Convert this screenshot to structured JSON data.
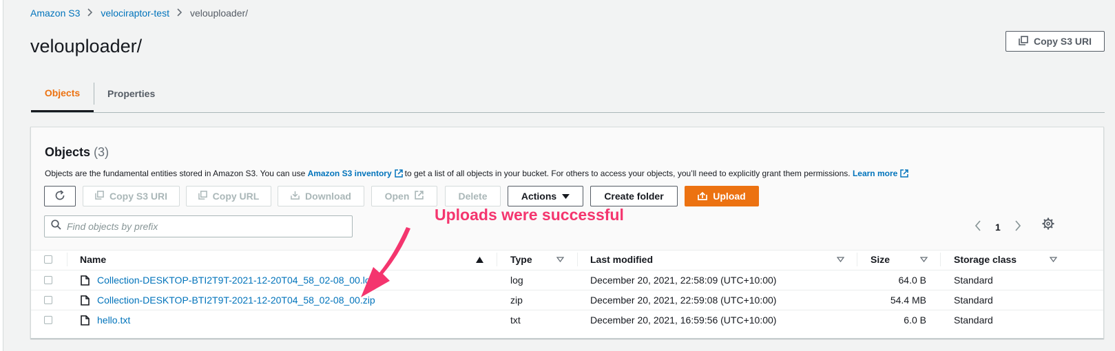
{
  "breadcrumb": {
    "root": "Amazon S3",
    "bucket": "velociraptor-test",
    "current": "velouploader/"
  },
  "page": {
    "title": "velouploader/",
    "copy_uri_label": "Copy S3 URI"
  },
  "tabs": [
    {
      "label": "Objects",
      "active": true
    },
    {
      "label": "Properties",
      "active": false
    }
  ],
  "objects_panel": {
    "title": "Objects",
    "count": "(3)",
    "desc_prefix": "Objects are the fundamental entities stored in Amazon S3. You can use",
    "inventory_link": "Amazon S3 inventory",
    "desc_middle": "to get a list of all objects in your bucket. For others to access your objects, you’ll need to explicitly grant them permissions.",
    "learn_more": "Learn more"
  },
  "toolbar": {
    "copy_s3_uri": "Copy S3 URI",
    "copy_url": "Copy URL",
    "download": "Download",
    "open": "Open",
    "delete": "Delete",
    "actions": "Actions",
    "create_folder": "Create folder",
    "upload": "Upload"
  },
  "search": {
    "placeholder": "Find objects by prefix",
    "value": ""
  },
  "pagination": {
    "current_page": "1"
  },
  "annotation": {
    "text": "Uploads were successful",
    "color": "#f4356e"
  },
  "table": {
    "columns": {
      "name": "Name",
      "type": "Type",
      "last_modified": "Last modified",
      "size": "Size",
      "storage_class": "Storage class"
    },
    "rows": [
      {
        "name": "Collection-DESKTOP-BTI2T9T-2021-12-20T04_58_02-08_00.log",
        "type": "log",
        "last_modified": "December 20, 2021, 22:58:09 (UTC+10:00)",
        "size": "64.0 B",
        "storage_class": "Standard"
      },
      {
        "name": "Collection-DESKTOP-BTI2T9T-2021-12-20T04_58_02-08_00.zip",
        "type": "zip",
        "last_modified": "December 20, 2021, 22:59:08 (UTC+10:00)",
        "size": "54.4 MB",
        "storage_class": "Standard"
      },
      {
        "name": "hello.txt",
        "type": "txt",
        "last_modified": "December 20, 2021, 16:59:56 (UTC+10:00)",
        "size": "6.0 B",
        "storage_class": "Standard"
      }
    ]
  },
  "colors": {
    "accent_orange": "#ec7211",
    "link_blue": "#0073bb",
    "text_dark": "#16191f"
  }
}
